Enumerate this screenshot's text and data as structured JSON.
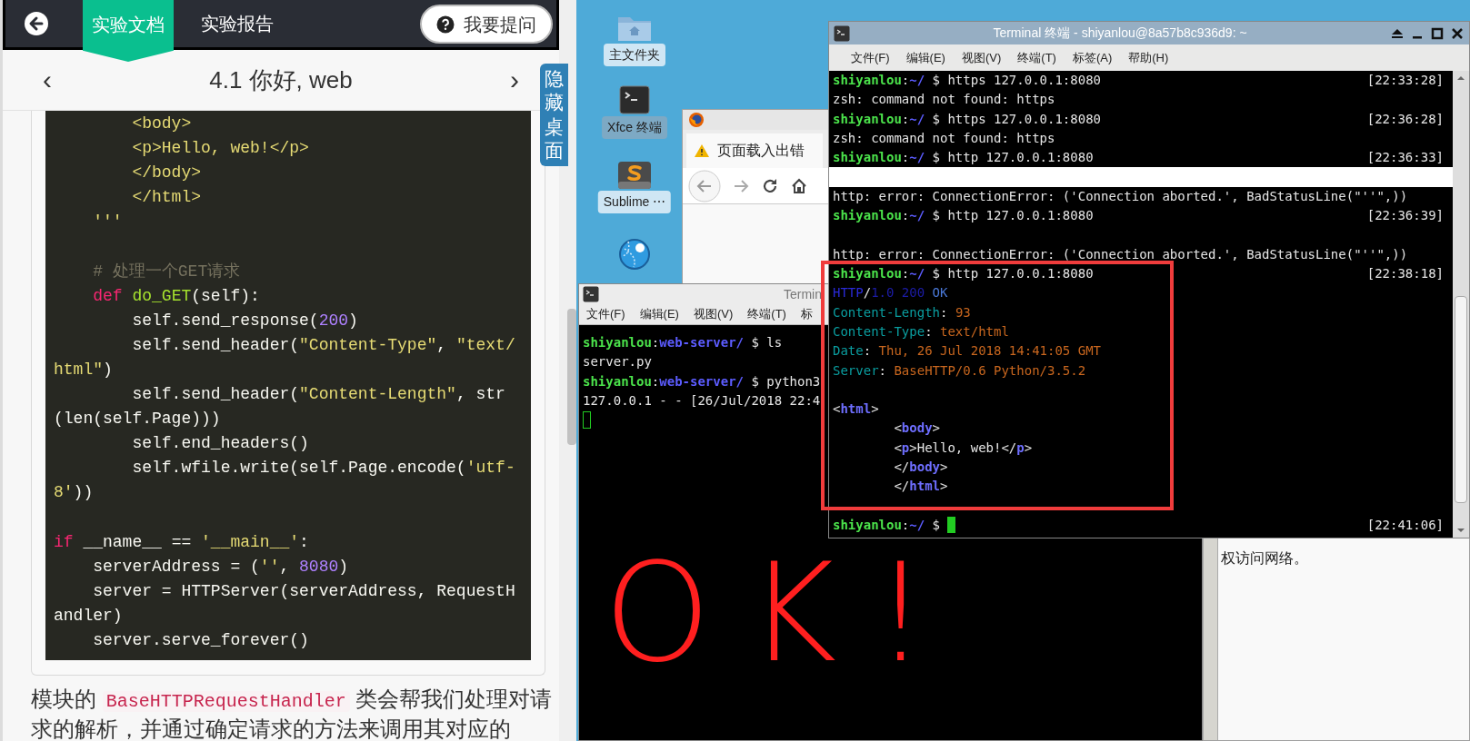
{
  "top_bar": {
    "tabs": [
      {
        "label": "实验文档",
        "selected": true
      },
      {
        "label": "实验报告",
        "selected": false
      }
    ],
    "ask_button": "我要提问"
  },
  "lesson_nav": {
    "prev": "‹",
    "title": "4.1 你好, web",
    "next": "›"
  },
  "hide_desktop_tab": "隐藏桌面",
  "code_lines": [
    [
      {
        "text": "        <body>",
        "kind": "string"
      }
    ],
    [
      {
        "text": "        <p>Hello, web!</p>",
        "kind": "string"
      }
    ],
    [
      {
        "text": "        </body>",
        "kind": "string"
      }
    ],
    [
      {
        "text": "        </html>",
        "kind": "string"
      }
    ],
    [
      {
        "text": "    '''",
        "kind": "string"
      }
    ],
    [
      {
        "kind": "blank"
      }
    ],
    [
      {
        "text": "    # 处理一个GET请求",
        "kind": "comment"
      }
    ],
    [
      {
        "text": "    def",
        "kind": "keyword"
      },
      {
        "text": " do_GET",
        "kind": "function"
      },
      {
        "text": "(self):",
        "kind": "plain"
      }
    ],
    [
      {
        "text": "        self.send_response(",
        "kind": "plain"
      },
      {
        "text": "200",
        "kind": "number"
      },
      {
        "text": ")",
        "kind": "plain"
      }
    ],
    [
      {
        "text": "        self.send_header(",
        "kind": "plain"
      },
      {
        "text": "\"Content-Type\"",
        "kind": "string"
      },
      {
        "text": ", ",
        "kind": "plain"
      },
      {
        "text": "\"text/",
        "kind": "string"
      }
    ],
    [
      {
        "text": "html\"",
        "kind": "string"
      },
      {
        "text": ")",
        "kind": "plain"
      }
    ],
    [
      {
        "text": "        self.send_header(",
        "kind": "plain"
      },
      {
        "text": "\"Content-Length\"",
        "kind": "string"
      },
      {
        "text": ", str",
        "kind": "plain"
      }
    ],
    [
      {
        "text": "(len(self.Page)))",
        "kind": "plain"
      }
    ],
    [
      {
        "text": "        self.end_headers()",
        "kind": "plain"
      }
    ],
    [
      {
        "text": "        self.wfile.write(self.Page.encode(",
        "kind": "plain"
      },
      {
        "text": "'utf-",
        "kind": "string"
      }
    ],
    [
      {
        "text": "8'",
        "kind": "string"
      },
      {
        "text": "))",
        "kind": "plain"
      }
    ],
    [
      {
        "kind": "blank"
      }
    ],
    [
      {
        "text": "if",
        "kind": "keyword"
      },
      {
        "text": " __name__ == ",
        "kind": "plain"
      },
      {
        "text": "'__main__'",
        "kind": "string"
      },
      {
        "text": ":",
        "kind": "plain"
      }
    ],
    [
      {
        "text": "    serverAddress = (",
        "kind": "plain"
      },
      {
        "text": "''",
        "kind": "string"
      },
      {
        "text": ", ",
        "kind": "plain"
      },
      {
        "text": "8080",
        "kind": "number"
      },
      {
        "text": ")",
        "kind": "plain"
      }
    ],
    [
      {
        "text": "    server = HTTPServer(serverAddress, RequestH",
        "kind": "plain"
      }
    ],
    [
      {
        "text": "andler)",
        "kind": "plain"
      }
    ],
    [
      {
        "text": "    server.serve_forever()",
        "kind": "plain"
      }
    ]
  ],
  "paragraph": [
    {
      "text": "模块的 ",
      "kind": "text"
    },
    {
      "text": "BaseHTTPRequestHandler",
      "kind": "code"
    },
    {
      "text": " 类会帮我们处理对请求的解析，并通过确定请求的方法来调用其对应的",
      "kind": "text"
    }
  ],
  "desktop_icons": [
    {
      "label": "主文件夹",
      "kind": "folder"
    },
    {
      "label": "Xfce 终端",
      "kind": "terminal"
    },
    {
      "label": "Sublime ⋯",
      "kind": "sublime"
    },
    {
      "kind": "globe"
    }
  ],
  "browser_window": {
    "tab": "页面载入出错",
    "page_text": "权访问网络。"
  },
  "small_terminal": {
    "title": "Termin",
    "menu": [
      "文件(F)",
      "编辑(E)",
      "视图(V)",
      "终端(T)",
      "标"
    ],
    "lines": [
      {
        "kind": "text",
        "segments": [
          {
            "text": "shiyanlou",
            "kind": "user"
          },
          {
            "text": ":",
            "kind": "plain"
          },
          {
            "text": "web-server/",
            "kind": "path"
          },
          {
            "text": " $ ls",
            "kind": "plain"
          }
        ]
      },
      {
        "kind": "text",
        "segments": [
          {
            "text": "server.py",
            "kind": "plain"
          }
        ]
      },
      {
        "kind": "text",
        "segments": [
          {
            "text": "shiyanlou",
            "kind": "user"
          },
          {
            "text": ":",
            "kind": "plain"
          },
          {
            "text": "web-server/",
            "kind": "path"
          },
          {
            "text": " $ python3",
            "kind": "plain"
          }
        ]
      },
      {
        "kind": "text",
        "segments": [
          {
            "text": "127.0.0.1 - - [26/Jul/2018 22:4",
            "kind": "plain"
          }
        ]
      },
      {
        "kind": "text",
        "segments": [
          {
            "kind": "cursor_outline"
          }
        ]
      }
    ]
  },
  "terminal": {
    "title": "Terminal 终端 - shiyanlou@8a57b8c936d9: ~",
    "menu": [
      "文件(F)",
      "编辑(E)",
      "视图(V)",
      "终端(T)",
      "标签(A)",
      "帮助(H)"
    ],
    "lines": [
      {
        "kind": "text",
        "segments": [
          {
            "text": "shiyanlou",
            "kind": "user"
          },
          {
            "text": ":",
            "kind": "plain"
          },
          {
            "text": "~/",
            "kind": "path"
          },
          {
            "text": " $ https 127.0.0.1:8080",
            "kind": "plain"
          }
        ],
        "time": "[22:33:28]"
      },
      {
        "kind": "text",
        "segments": [
          {
            "text": "zsh: command not found: https",
            "kind": "plain"
          }
        ]
      },
      {
        "kind": "text",
        "segments": [
          {
            "text": "shiyanlou",
            "kind": "user"
          },
          {
            "text": ":",
            "kind": "plain"
          },
          {
            "text": "~/",
            "kind": "path"
          },
          {
            "text": " $ https 127.0.0.1:8080",
            "kind": "plain"
          }
        ],
        "time": "[22:36:28]"
      },
      {
        "kind": "text",
        "segments": [
          {
            "text": "zsh: command not found: https",
            "kind": "plain"
          }
        ]
      },
      {
        "kind": "text",
        "segments": [
          {
            "text": "shiyanlou",
            "kind": "user"
          },
          {
            "text": ":",
            "kind": "plain"
          },
          {
            "text": "~/",
            "kind": "path"
          },
          {
            "text": " $ http 127.0.0.1:8080",
            "kind": "plain"
          }
        ],
        "time": "[22:36:33]"
      },
      {
        "kind": "bar"
      },
      {
        "kind": "text",
        "segments": [
          {
            "text": "http: error: ConnectionError: ('Connection aborted.', BadStatusLine(\"''\",))",
            "kind": "plain"
          }
        ]
      },
      {
        "kind": "text",
        "segments": [
          {
            "text": "shiyanlou",
            "kind": "user"
          },
          {
            "text": ":",
            "kind": "plain"
          },
          {
            "text": "~/",
            "kind": "path"
          },
          {
            "text": " $ http 127.0.0.1:8080",
            "kind": "plain"
          }
        ],
        "time": "[22:36:39]"
      },
      {
        "kind": "blank"
      },
      {
        "kind": "text",
        "segments": [
          {
            "text": "http: error: ConnectionError: ('Connection aborted.', BadStatusLine(\"''\",))",
            "kind": "plain"
          }
        ]
      },
      {
        "kind": "text",
        "segments": [
          {
            "text": "shiyanlou",
            "kind": "user"
          },
          {
            "text": ":",
            "kind": "plain"
          },
          {
            "text": "~/",
            "kind": "path"
          },
          {
            "text": " $ http 127.0.0.1:8080",
            "kind": "plain"
          }
        ],
        "time": "[22:38:18]"
      },
      {
        "kind": "text",
        "segments": [
          {
            "text": "HTTP",
            "kind": "proto"
          },
          {
            "text": "/",
            "kind": "plain"
          },
          {
            "text": "1.0 200",
            "kind": "status"
          },
          {
            "text": " OK",
            "kind": "reason"
          }
        ]
      },
      {
        "kind": "text",
        "segments": [
          {
            "text": "Content-Length",
            "kind": "key"
          },
          {
            "text": ": ",
            "kind": "plain"
          },
          {
            "text": "93",
            "kind": "value"
          }
        ]
      },
      {
        "kind": "text",
        "segments": [
          {
            "text": "Content-Type",
            "kind": "key"
          },
          {
            "text": ": ",
            "kind": "plain"
          },
          {
            "text": "text/html",
            "kind": "value"
          }
        ]
      },
      {
        "kind": "text",
        "segments": [
          {
            "text": "Date",
            "kind": "key"
          },
          {
            "text": ": ",
            "kind": "plain"
          },
          {
            "text": "Thu, 26 Jul 2018 14:41:05 GMT",
            "kind": "value"
          }
        ]
      },
      {
        "kind": "text",
        "segments": [
          {
            "text": "Server",
            "kind": "key"
          },
          {
            "text": ": ",
            "kind": "plain"
          },
          {
            "text": "BaseHTTP/0.6 Python/3.5.2",
            "kind": "value"
          }
        ]
      },
      {
        "kind": "blank"
      },
      {
        "kind": "text",
        "segments": [
          {
            "text": "<",
            "kind": "plain"
          },
          {
            "text": "html",
            "kind": "tag"
          },
          {
            "text": ">",
            "kind": "plain"
          }
        ]
      },
      {
        "kind": "text",
        "segments": [
          {
            "text": "        <",
            "kind": "plain"
          },
          {
            "text": "body",
            "kind": "tag"
          },
          {
            "text": ">",
            "kind": "plain"
          }
        ]
      },
      {
        "kind": "text",
        "segments": [
          {
            "text": "        <",
            "kind": "plain"
          },
          {
            "text": "p",
            "kind": "tag"
          },
          {
            "text": ">Hello, web!</",
            "kind": "plain"
          },
          {
            "text": "p",
            "kind": "tag"
          },
          {
            "text": ">",
            "kind": "plain"
          }
        ]
      },
      {
        "kind": "text",
        "segments": [
          {
            "text": "        </",
            "kind": "plain"
          },
          {
            "text": "body",
            "kind": "tag"
          },
          {
            "text": ">",
            "kind": "plain"
          }
        ]
      },
      {
        "kind": "text",
        "segments": [
          {
            "text": "        </",
            "kind": "plain"
          },
          {
            "text": "html",
            "kind": "tag"
          },
          {
            "text": ">",
            "kind": "plain"
          }
        ]
      },
      {
        "kind": "blank"
      },
      {
        "kind": "text",
        "segments": [
          {
            "text": "shiyanlou",
            "kind": "user"
          },
          {
            "text": ":",
            "kind": "plain"
          },
          {
            "text": "~/",
            "kind": "path"
          },
          {
            "text": " $ ",
            "kind": "plain"
          },
          {
            "kind": "cursor"
          }
        ],
        "time": "[22:41:06]"
      }
    ]
  },
  "annotation": {
    "text": "OK!"
  }
}
